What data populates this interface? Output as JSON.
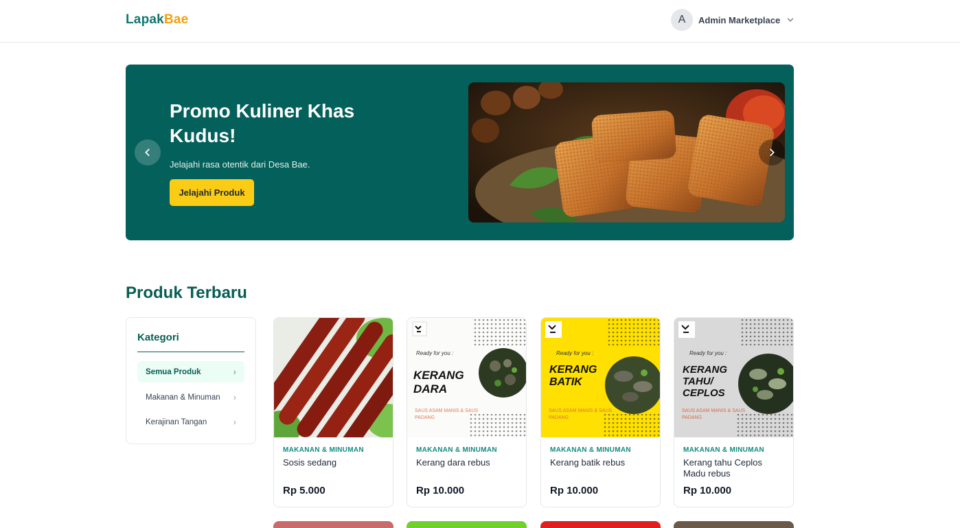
{
  "header": {
    "brand_part1": "Lapak",
    "brand_part2": "Bae",
    "avatar_initial": "A",
    "user_name": "Admin Marketplace"
  },
  "hero": {
    "title": "Promo Kuliner Khas Kudus!",
    "subtitle": "Jelajahi rasa otentik dari Desa Bae.",
    "cta_label": "Jelajahi Produk"
  },
  "section_title": "Produk Terbaru",
  "categories": {
    "title": "Kategori",
    "items": [
      {
        "label": "Semua Produk"
      },
      {
        "label": "Makanan & Minuman"
      },
      {
        "label": "Kerajinan Tangan"
      }
    ]
  },
  "products": [
    {
      "category": "MAKANAN & MINUMAN",
      "name": "Sosis sedang",
      "price": "Rp 5.000"
    },
    {
      "category": "MAKANAN & MINUMAN",
      "name": "Kerang dara rebus",
      "price": "Rp 10.000",
      "poster": {
        "l1": "KERANG",
        "l2": "DARA",
        "ready": "Ready for you :",
        "sauce": "SAUS ASAM MANIS & SAUS PADANG"
      }
    },
    {
      "category": "MAKANAN & MINUMAN",
      "name": "Kerang batik rebus",
      "price": "Rp 10.000",
      "poster": {
        "l1": "KERANG",
        "l2": "BATIK",
        "ready": "Ready for you :",
        "sauce": "SAUS ASAM MANIS & SAUS PADANG"
      }
    },
    {
      "category": "MAKANAN & MINUMAN",
      "name": "Kerang tahu Ceplos Madu rebus",
      "price": "Rp 10.000",
      "poster": {
        "l1": "KERANG",
        "l2": "TAHU/",
        "l3": "CEPLOS",
        "ready": "Ready for you :",
        "sauce": "SAUS ASAM MANIS & SAUS PADANG"
      }
    }
  ],
  "colors": {
    "primary": "#075e54",
    "hero_bg": "#03605a",
    "accent": "#facc15",
    "brand_orange": "#f59e0b"
  }
}
